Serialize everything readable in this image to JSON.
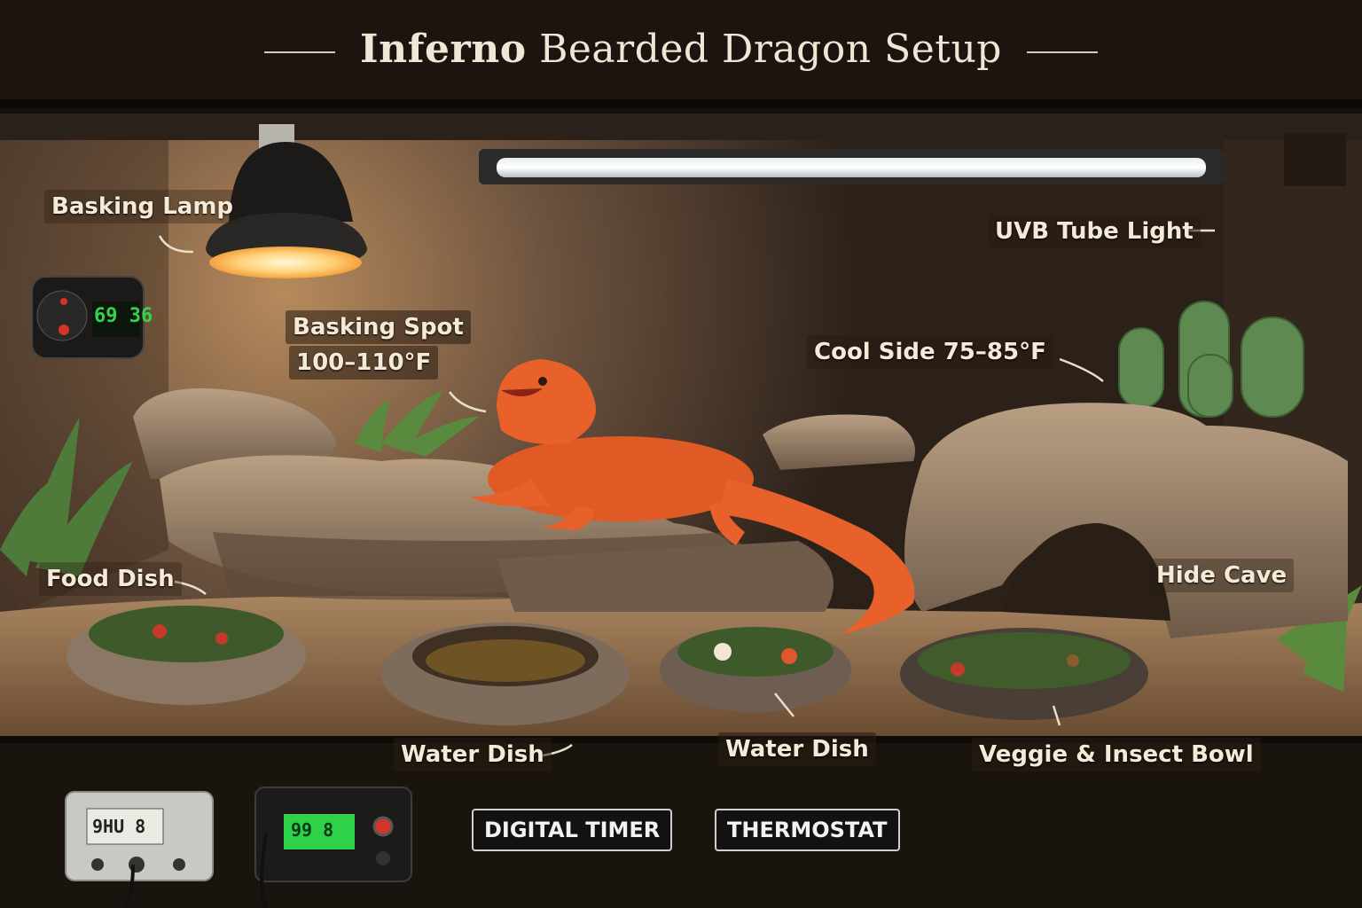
{
  "title": {
    "bold": "Inferno",
    "rest": "Bearded Dragon Setup"
  },
  "callouts": {
    "basking_lamp": "Basking Lamp",
    "uvb_tube": "UVB Tube Light",
    "basking_spot_name": "Basking Spot",
    "basking_spot_temp": "100–110°F",
    "cool_side": "Cool Side 75–85°F",
    "food_dish": "Food Dish",
    "hide_cave": "Hide Cave",
    "water_dish_left": "Water Dish",
    "water_dish_center": "Water Dish",
    "veggie_bowl": "Veggie & Insect Bowl"
  },
  "controls": {
    "digital_timer": "DIGITAL TIMER",
    "thermostat": "THERMOSTAT"
  },
  "displays": {
    "wall_thermostat": "69 36",
    "bottom_left_device": "9HU 8",
    "bottom_right_device": "99 8"
  },
  "colors": {
    "lcd_green": "#34d24a",
    "dragon_orange": "#e8602a",
    "frame_dark": "#1a130d"
  }
}
